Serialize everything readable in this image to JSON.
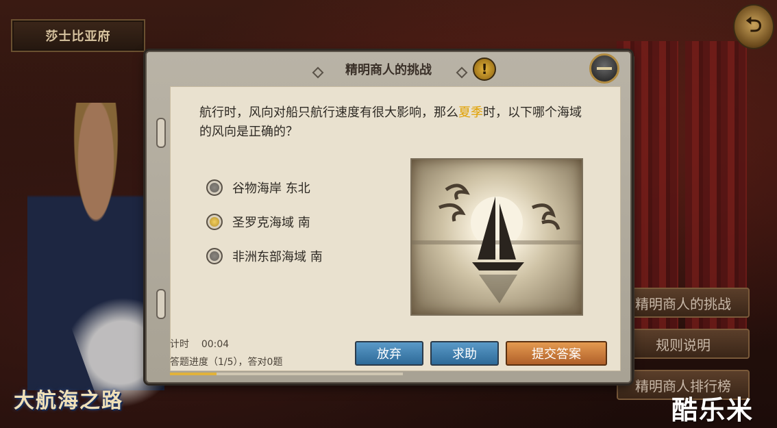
{
  "location": "莎士比亚府",
  "dialog": {
    "title": "精明商人的挑战",
    "question_before": "航行时，风向对船只航行速度有很大影响，那么",
    "question_highlight": "夏季",
    "question_after": "时，以下哪个海域的风向是正确的？",
    "options": [
      {
        "label": "谷物海岸 东北",
        "selected": false
      },
      {
        "label": "圣罗克海域 南",
        "selected": true
      },
      {
        "label": "非洲东部海域 南",
        "selected": false
      }
    ],
    "timer_label": "计时",
    "timer_value": "00:04",
    "progress_text": "答题进度（1/5），答对0题",
    "progress_fraction": 0.2,
    "buttons": {
      "abandon": "放弃",
      "help": "求助",
      "submit": "提交答案"
    }
  },
  "side_menu": [
    "精明商人的挑战",
    "规则说明",
    "精明商人排行榜"
  ],
  "game_logo": "大航海之路",
  "watermark": "酷乐米",
  "icons": {
    "back": "back-arrow-icon",
    "alert": "exclamation-icon",
    "minimize": "minimize-icon"
  }
}
